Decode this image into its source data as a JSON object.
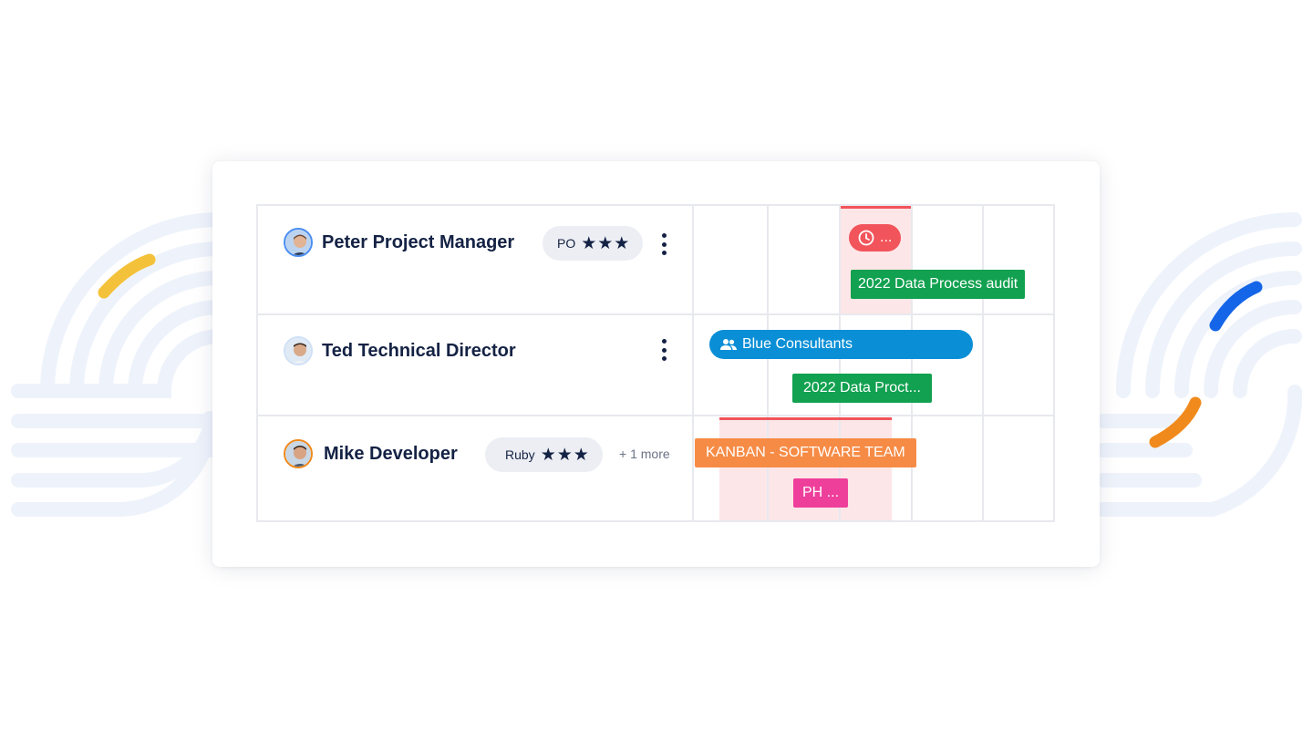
{
  "colors": {
    "navy": "#142244",
    "green": "#12a150",
    "blue": "#0a8fd6",
    "orange": "#f68b45",
    "pink": "#ee3f9b",
    "red": "#f2545b",
    "shade": "#fde6e7",
    "deco_yellow": "#f4c23a",
    "deco_blue": "#1565e8",
    "deco_orange": "#f08a1c"
  },
  "people": [
    {
      "name": "Peter Project Manager",
      "skill": {
        "label": "PO",
        "stars": "★★★",
        "rating": 3
      },
      "menu_icon": "more-vertical-icon"
    },
    {
      "name": "Ted Technical Director",
      "menu_icon": "more-vertical-icon"
    },
    {
      "name": "Mike Developer",
      "skill": {
        "label": "Ruby",
        "stars": "★★★",
        "rating": 3
      },
      "more": "+ 1 more"
    }
  ],
  "bookings": {
    "time_off": {
      "label": "...",
      "icon": "clock-icon"
    },
    "audit_full": "2022 Data Process audit",
    "blue_consultants": {
      "label": "Blue Consultants",
      "icon": "people-icon"
    },
    "audit_short": "2022 Data Proct...",
    "kanban": "KANBAN - SOFTWARE TEAM",
    "ph": "PH ..."
  }
}
